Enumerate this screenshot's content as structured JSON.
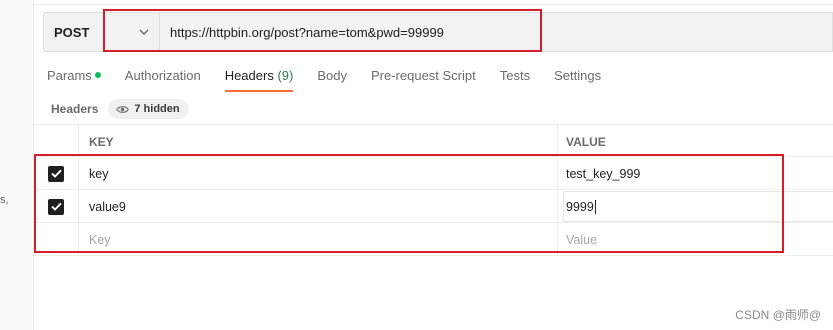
{
  "left_rail": {
    "fragment": "s,"
  },
  "request": {
    "method": "POST",
    "url": "https://httpbin.org/post?name=tom&pwd=99999"
  },
  "tabs": [
    {
      "label": "Params",
      "has_dot": true
    },
    {
      "label": "Authorization"
    },
    {
      "label": "Headers",
      "count": "(9)",
      "active": true
    },
    {
      "label": "Body"
    },
    {
      "label": "Pre-request Script"
    },
    {
      "label": "Tests"
    },
    {
      "label": "Settings"
    }
  ],
  "headers_section": {
    "title": "Headers",
    "hidden_label": "7 hidden"
  },
  "table": {
    "columns": {
      "key": "KEY",
      "value": "VALUE"
    },
    "rows": [
      {
        "checked": true,
        "key": "key",
        "value": "test_key_999"
      },
      {
        "checked": true,
        "key": "value9",
        "value": "9999"
      }
    ],
    "placeholder": {
      "key": "Key",
      "value": "Value"
    }
  },
  "colors": {
    "accent_tab_underline": "#ff6c37",
    "params_dot": "#0cbb52",
    "annotation_box": "#d21f2a"
  },
  "icons": {
    "method_dropdown": "chevron-down-icon",
    "hidden_toggle": "eye-icon",
    "checkbox": "checkmark-icon"
  },
  "watermark": "CSDN @雨师@"
}
